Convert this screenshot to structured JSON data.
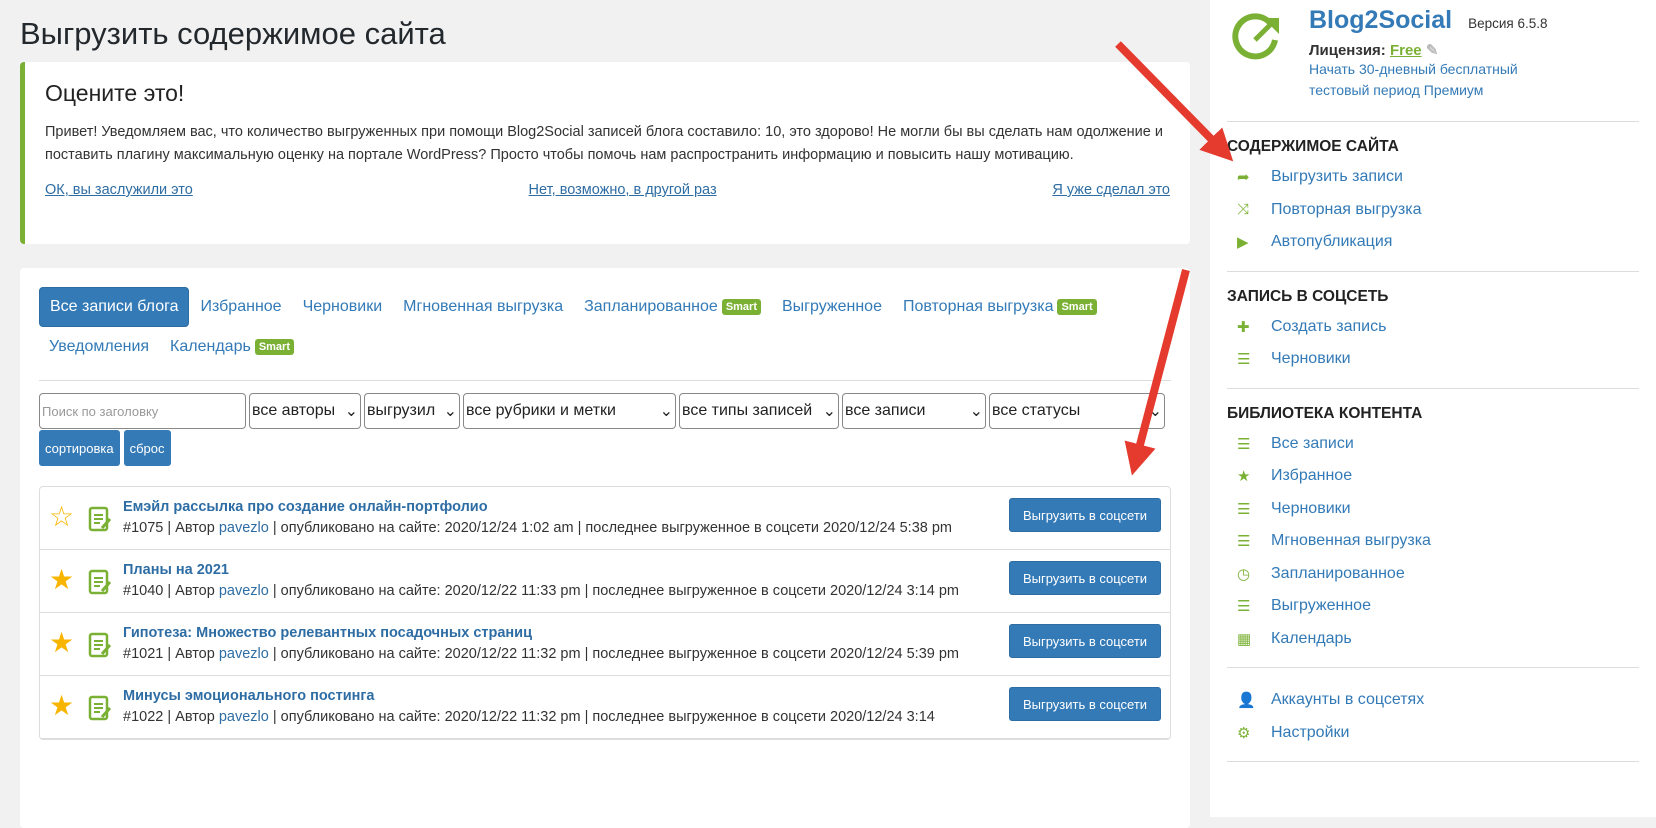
{
  "page_title": "Выгрузить содержимое сайта",
  "notice": {
    "title": "Оцените это!",
    "text": "Привет! Уведомляем вас, что количество выгруженных при помощи Blog2Social записей блога составило: 10, это здорово! Не могли бы вы сделать нам одолжение и поставить плагину максимальную оценку на портале WordPress? Просто чтобы помочь нам распространить информацию и повысить нашу мотивацию.",
    "link_ok": "ОК, вы заслужили это",
    "link_later": "Нет, возможно, в другой раз",
    "link_done": "Я уже сделал это"
  },
  "tabs": [
    {
      "label": "Все записи блога"
    },
    {
      "label": "Избранное"
    },
    {
      "label": "Черновики"
    },
    {
      "label": "Мгновенная выгрузка"
    },
    {
      "label": "Запланированное",
      "badge": "Smart"
    },
    {
      "label": "Выгруженное"
    },
    {
      "label": "Повторная выгрузка",
      "badge": "Smart"
    },
    {
      "label": "Уведомления"
    },
    {
      "label": "Календарь",
      "badge": "Smart"
    }
  ],
  "filters": {
    "search_placeholder": "Поиск по заголовку",
    "authors": "все авторы",
    "uploaded_by": "выгрузил",
    "categories": "все рубрики и метки",
    "types": "все типы записей",
    "posts": "все записи",
    "statuses": "все статусы",
    "sort": "сортировка",
    "reset": "сброс"
  },
  "posts": [
    {
      "title": "Емэйл рассылка про создание онлайн-портфолио",
      "id": "#1075 | Автор ",
      "author": "pavezlo",
      "meta": " | опубликовано на сайте: 2020/12/24 1:02 am | последнее выгруженное в соцсети 2020/12/24 5:38 pm",
      "favorite": false
    },
    {
      "title": "Планы на 2021",
      "id": "#1040 | Автор ",
      "author": "pavezlo",
      "meta": " | опубликовано на сайте: 2020/12/22 11:33 pm | последнее выгруженное в соцсети 2020/12/24 3:14 pm",
      "favorite": true
    },
    {
      "title": "Гипотеза: Множество релевантных посадочных страниц",
      "id": "#1021 | Автор ",
      "author": "pavezlo",
      "meta": " | опубликовано на сайте: 2020/12/22 11:32 pm | последнее выгруженное в соцсети 2020/12/24 5:39 pm",
      "favorite": true
    },
    {
      "title": "Минусы эмоционального постинга",
      "id": "#1022 | Автор ",
      "author": "pavezlo",
      "meta": " | опубликовано на сайте: 2020/12/22 11:32 pm | последнее выгруженное в соцсети 2020/12/24 3:14",
      "favorite": true
    }
  ],
  "post_button": "Выгрузить в соцсети",
  "sidebar": {
    "brand": "Blog2Social",
    "version": "Версия 6.5.8",
    "license_label": "Лицензия: ",
    "license": "Free",
    "trial": "Начать 30-дневный бесплатный тестовый период Премиум",
    "sections": [
      {
        "title": "СОДЕРЖИМОЕ САЙТА",
        "items": [
          {
            "icon": "share-icon",
            "glyph": "➦",
            "label": "Выгрузить записи"
          },
          {
            "icon": "shuffle-icon",
            "glyph": "⤨",
            "label": "Повторная выгрузка"
          },
          {
            "icon": "play-icon",
            "glyph": "▶",
            "label": "Автопубликация"
          }
        ]
      },
      {
        "title": "ЗАПИСЬ В СОЦСЕТЬ",
        "items": [
          {
            "icon": "plus-icon",
            "glyph": "✚",
            "label": "Создать запись"
          },
          {
            "icon": "list-icon",
            "glyph": "☰",
            "label": "Черновики"
          }
        ]
      },
      {
        "title": "БИБЛИОТЕКА КОНТЕНТА",
        "items": [
          {
            "icon": "list-icon",
            "glyph": "☰",
            "label": "Все записи"
          },
          {
            "icon": "star-icon",
            "glyph": "★",
            "label": "Избранное"
          },
          {
            "icon": "list-icon",
            "glyph": "☰",
            "label": "Черновики"
          },
          {
            "icon": "list-icon",
            "glyph": "☰",
            "label": "Мгновенная выгрузка"
          },
          {
            "icon": "clock-icon",
            "glyph": "◷",
            "label": "Запланированное"
          },
          {
            "icon": "list-icon",
            "glyph": "☰",
            "label": "Выгруженное"
          },
          {
            "icon": "calendar-icon",
            "glyph": "▦",
            "label": "Календарь"
          }
        ]
      },
      {
        "title": "",
        "items": [
          {
            "icon": "user-icon",
            "glyph": "👤",
            "label": "Аккаунты в соцсетях"
          },
          {
            "icon": "gear-icon",
            "glyph": "⚙",
            "label": "Настройки"
          }
        ]
      }
    ]
  },
  "colors": {
    "accent": "#337ab7",
    "green": "#7ab135",
    "arrow": "#e53a2e"
  }
}
